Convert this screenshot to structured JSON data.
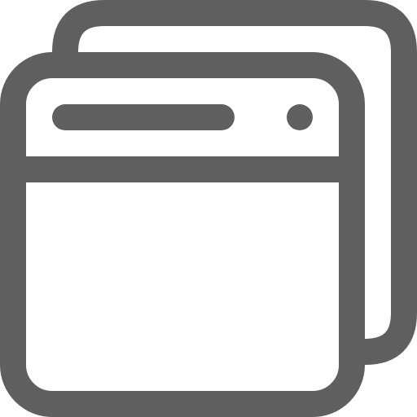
{
  "icon": {
    "name": "multiple-windows-icon",
    "stroke_color": "#5f5f5f",
    "fill_color": "#ffffff"
  }
}
